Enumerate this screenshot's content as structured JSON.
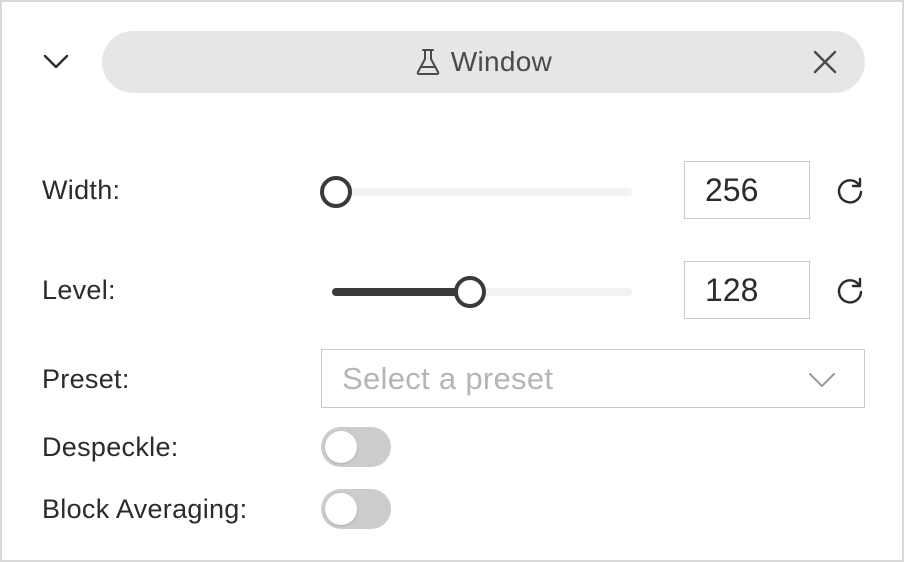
{
  "header": {
    "title": "Window",
    "title_icon": "flask-icon",
    "collapse_icon": "chevron-down-icon",
    "close_icon": "close-icon"
  },
  "width": {
    "label": "Width:",
    "value": "256",
    "slider_fraction": 0.0,
    "reset_icon": "reset-icon"
  },
  "level": {
    "label": "Level:",
    "value": "128",
    "slider_fraction": 0.5,
    "reset_icon": "reset-icon"
  },
  "preset": {
    "label": "Preset:",
    "placeholder": "Select a preset",
    "chevron_icon": "chevron-down-icon"
  },
  "despeckle": {
    "label": "Despeckle:",
    "enabled": false
  },
  "block_averaging": {
    "label": "Block Averaging:",
    "enabled": false
  },
  "colors": {
    "pill_background": "#e6e6e6",
    "slider_fill": "#3a3a3a",
    "slider_track": "#f2f2f2",
    "toggle_off": "#cccccc",
    "placeholder_text": "#b5b5b5"
  }
}
